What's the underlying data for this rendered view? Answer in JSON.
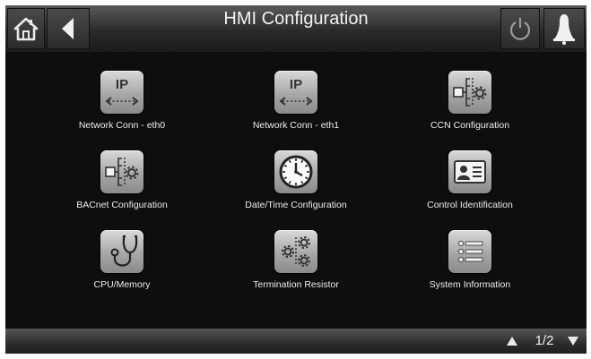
{
  "header": {
    "title": "HMI Configuration"
  },
  "icons": {
    "home": "home-icon",
    "back": "back-arrow-icon",
    "power": "power-icon",
    "alarm": "alarm-bell-icon"
  },
  "tiles": [
    {
      "label": "Network Conn - eth0",
      "icon": "network-ip-icon"
    },
    {
      "label": "Network Conn - eth1",
      "icon": "network-ip-icon"
    },
    {
      "label": "CCN Configuration",
      "icon": "network-config-icon"
    },
    {
      "label": "BACnet Configuration",
      "icon": "network-config-icon"
    },
    {
      "label": "Date/Time Configuration",
      "icon": "clock-icon"
    },
    {
      "label": "Control Identification",
      "icon": "id-card-icon"
    },
    {
      "label": "CPU/Memory",
      "icon": "stethoscope-icon"
    },
    {
      "label": "Termination Resistor",
      "icon": "gears-icon"
    },
    {
      "label": "System Information",
      "icon": "list-icon"
    }
  ],
  "ip_text": "IP",
  "pagination": {
    "page": "1/2"
  }
}
